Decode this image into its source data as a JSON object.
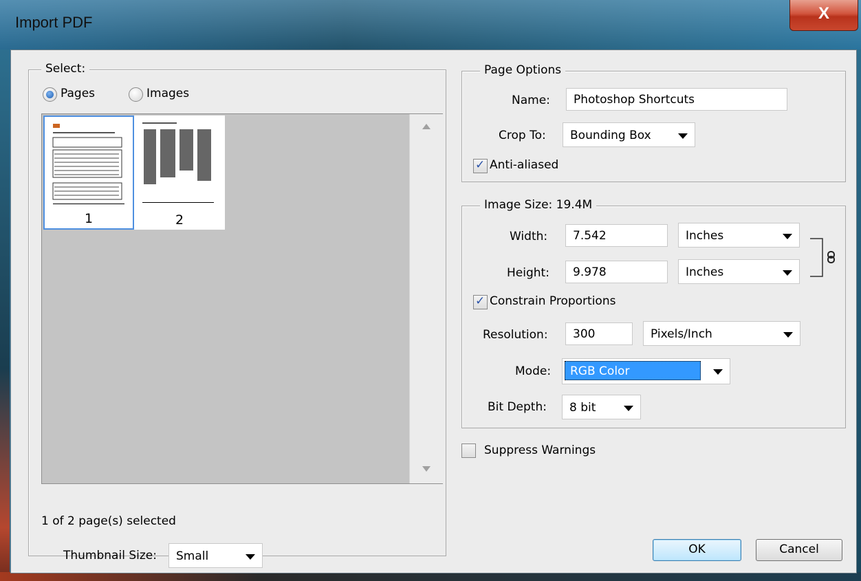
{
  "window": {
    "title": "Import PDF",
    "close_glyph": "X"
  },
  "select": {
    "legend": "Select:",
    "radio_pages": "Pages",
    "radio_images": "Images",
    "selected_mode": "Pages",
    "thumbnails": [
      {
        "number": "1",
        "selected": true
      },
      {
        "number": "2",
        "selected": false
      }
    ],
    "status": "1 of 2 page(s) selected",
    "thumb_size_label": "Thumbnail Size:",
    "thumb_size_value": "Small"
  },
  "page_options": {
    "legend": "Page Options",
    "name_label": "Name:",
    "name_value": "Photoshop Shortcuts",
    "crop_label": "Crop To:",
    "crop_value": "Bounding Box",
    "anti_aliased_label": "Anti-aliased",
    "anti_aliased": true
  },
  "image_size": {
    "legend": "Image Size: 19.4M",
    "width_label": "Width:",
    "width_value": "7.542",
    "width_unit": "Inches",
    "height_label": "Height:",
    "height_value": "9.978",
    "height_unit": "Inches",
    "constrain_label": "Constrain Proportions",
    "constrain": true,
    "resolution_label": "Resolution:",
    "resolution_value": "300",
    "resolution_unit": "Pixels/Inch",
    "mode_label": "Mode:",
    "mode_value": "RGB Color",
    "bitdepth_label": "Bit Depth:",
    "bitdepth_value": "8 bit"
  },
  "suppress_warnings_label": "Suppress Warnings",
  "suppress_warnings": false,
  "buttons": {
    "ok": "OK",
    "cancel": "Cancel"
  },
  "colors": {
    "selection": "#3399ff",
    "dialog_bg": "#ececec",
    "close_red": "#c9472e"
  }
}
